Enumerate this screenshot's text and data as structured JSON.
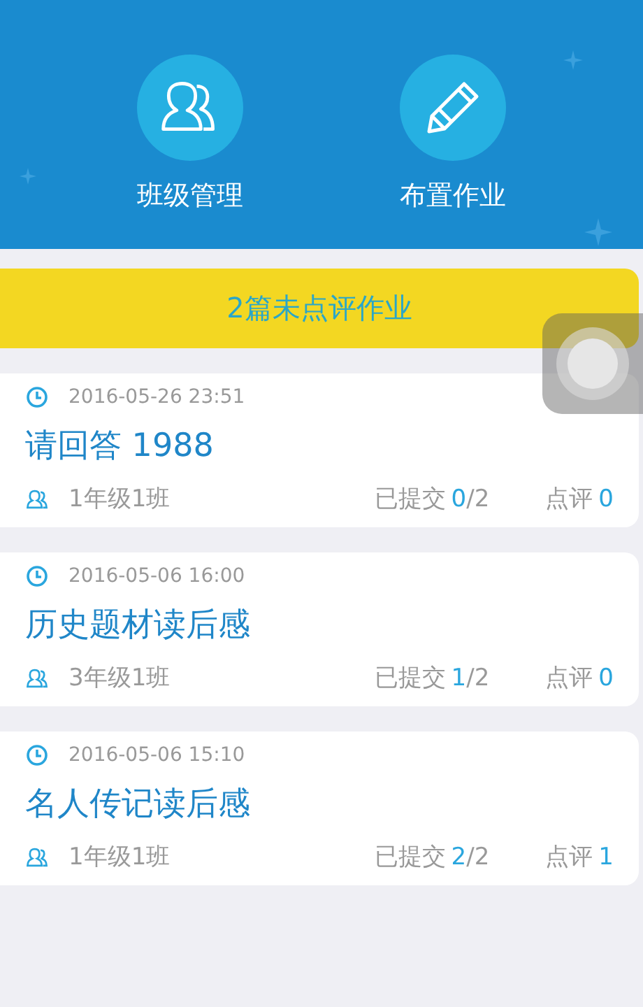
{
  "header": {
    "actions": [
      {
        "kind": "class",
        "label": "班级管理"
      },
      {
        "kind": "assign",
        "label": "布置作业"
      }
    ]
  },
  "banner": {
    "label": "2篇未点评作业"
  },
  "assignments": [
    {
      "time": "2016-05-26 23:51",
      "title": "请回答 1988",
      "class_name": "1年级1班",
      "submitted_label": "已提交",
      "submitted_count": "0",
      "submitted_total": "/2",
      "review_label": "点评",
      "review_count": "0"
    },
    {
      "time": "2016-05-06 16:00",
      "title": "历史题材读后感",
      "class_name": "3年级1班",
      "submitted_label": "已提交",
      "submitted_count": "1",
      "submitted_total": "/2",
      "review_label": "点评",
      "review_count": "0"
    },
    {
      "time": "2016-05-06 15:10",
      "title": "名人传记读后感",
      "class_name": "1年级1班",
      "submitted_label": "已提交",
      "submitted_count": "2",
      "submitted_total": "/2",
      "review_label": "点评",
      "review_count": "1"
    }
  ]
}
